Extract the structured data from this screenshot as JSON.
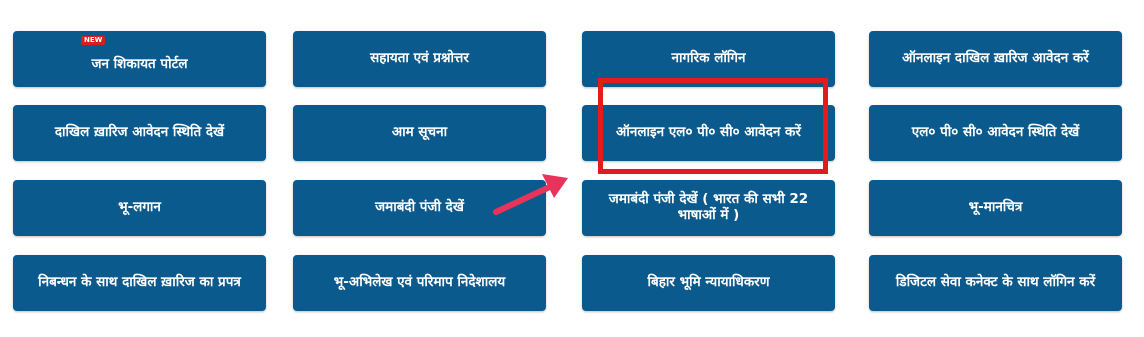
{
  "new_badge": "NEW",
  "colors": {
    "tile_bg": "#0b5a8e",
    "tile_text": "#ffffff",
    "highlight": "#e31b1b",
    "arrow": "#e8345a"
  },
  "tiles": [
    {
      "label": "जन शिकायत पोर्टल"
    },
    {
      "label": "सहायता एवं प्रश्नोत्तर"
    },
    {
      "label": "नागरिक लॉगिन"
    },
    {
      "label": "ऑनलाइन दाखिल ख़ारिज आवेदन करें"
    },
    {
      "label": "दाखिल ख़ारिज आवेदन स्थिति देखें"
    },
    {
      "label": "आम सूचना"
    },
    {
      "label": "ऑनलाइन एल० पी० सी० आवेदन करें"
    },
    {
      "label": "एल० पी० सी० आवेदन स्थिति देखें"
    },
    {
      "label": "भू-लगान"
    },
    {
      "label": "जमाबंदी पंजी देखें"
    },
    {
      "label": "जमाबंदी पंजी देखें ( भारत की सभी 22 भाषाओं में )"
    },
    {
      "label": "भू-मानचित्र"
    },
    {
      "label": "निबन्धन के साथ दाखिल ख़ारिज का प्रपत्र"
    },
    {
      "label": "भू-अभिलेख एवं परिमाप निदेशालय"
    },
    {
      "label": "बिहार भूमि न्यायाधिकरण"
    },
    {
      "label": "डिजिटल सेवा कनेक्ट के साथ लॉगिन करें"
    }
  ]
}
